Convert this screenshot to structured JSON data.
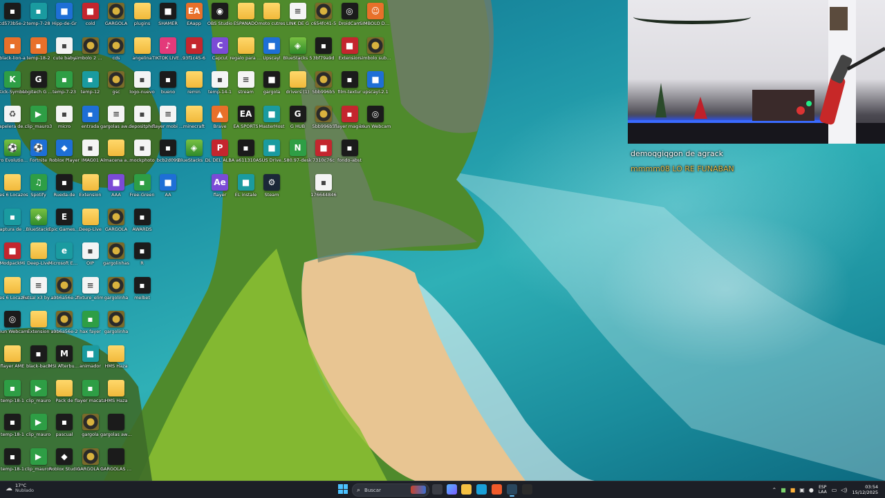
{
  "desktop": {
    "columns": [
      {
        "icons": [
          {
            "label": "cd573b5e-2",
            "icon": "image-file-icon",
            "style": "dark"
          },
          {
            "label": "black-lion-a",
            "icon": "image-file-icon",
            "style": "orange"
          },
          {
            "label": "Kick-Symbol",
            "icon": "kick-icon",
            "style": "green"
          },
          {
            "label": "Papelera de reciclaje",
            "icon": "recycle-bin-icon",
            "style": "doc"
          },
          {
            "label": "Pro Evolution Soccer 6",
            "icon": "game-icon",
            "style": "lime"
          },
          {
            "label": "Pes 6 Locazos",
            "icon": "folder-icon",
            "style": "folder"
          },
          {
            "label": "Captura de pantalla",
            "icon": "image-file-icon",
            "style": "teal"
          },
          {
            "label": "ModpackMi",
            "icon": "app-icon",
            "style": "red"
          },
          {
            "label": "Pes 6 Locazos",
            "icon": "folder-icon",
            "style": "folder"
          },
          {
            "label": "iriun Webcam",
            "icon": "webcam-icon",
            "style": "dark"
          },
          {
            "label": "flayer AME",
            "icon": "folder-icon",
            "style": "folder"
          },
          {
            "label": "temp-18-1",
            "icon": "image-file-icon",
            "style": "green"
          },
          {
            "label": "temp-18-1",
            "icon": "image-file-icon",
            "style": "dark"
          },
          {
            "label": "temp-18-1",
            "icon": "image-file-icon",
            "style": "dark"
          }
        ]
      },
      {
        "icons": [
          {
            "label": "temp-7-28",
            "icon": "image-file-icon",
            "style": "teal"
          },
          {
            "label": "temp-18-2",
            "icon": "image-file-icon",
            "style": "orange"
          },
          {
            "label": "Logitech G HUB",
            "icon": "logitech-icon",
            "style": "dark"
          },
          {
            "label": "clip_mauro3",
            "icon": "video-file-icon",
            "style": "green"
          },
          {
            "label": "Fortnite",
            "icon": "game-icon",
            "style": "blue"
          },
          {
            "label": "Spotify",
            "icon": "spotify-icon",
            "style": "green"
          },
          {
            "label": "BlueStacks",
            "icon": "bluestacks-icon",
            "style": "lime"
          },
          {
            "label": "Deep-Live",
            "icon": "folder-icon",
            "style": "folder"
          },
          {
            "label": "Futsal x3 by Bazinga",
            "icon": "document-icon",
            "style": "doc"
          },
          {
            "label": "Extension",
            "icon": "folder-icon",
            "style": "folder"
          },
          {
            "label": "black-back",
            "icon": "image-file-icon",
            "style": "dark"
          },
          {
            "label": "clip_mauro",
            "icon": "video-file-icon",
            "style": "green"
          },
          {
            "label": "clip_mauro",
            "icon": "video-file-icon",
            "style": "green"
          },
          {
            "label": "clip_mauro4",
            "icon": "video-file-icon",
            "style": "green"
          }
        ]
      },
      {
        "icons": [
          {
            "label": "Hipp-de-Gr",
            "icon": "app-icon",
            "style": "blue"
          },
          {
            "label": "cute baby",
            "icon": "image-file-icon",
            "style": "doc"
          },
          {
            "label": "temp-7-23",
            "icon": "image-file-icon",
            "style": "green"
          },
          {
            "label": "micro",
            "icon": "image-file-icon",
            "style": "doc"
          },
          {
            "label": "Roblox Player",
            "icon": "roblox-icon",
            "style": "blue"
          },
          {
            "label": "Rueda-de",
            "icon": "image-file-icon",
            "style": "dark"
          },
          {
            "label": "Epic Games Launcher",
            "icon": "epic-icon",
            "style": "dark"
          },
          {
            "label": "Microsoft Edge",
            "icon": "edge-icon",
            "style": "teal"
          },
          {
            "label": "a9b6a56e-2",
            "icon": "gold-logo-icon",
            "style": "gold"
          },
          {
            "label": "a9b6a56e-2",
            "icon": "gold-logo-icon",
            "style": "gold"
          },
          {
            "label": "MSI Afterburner",
            "icon": "msi-icon",
            "style": "dark"
          },
          {
            "label": "Pack de",
            "icon": "folder-icon",
            "style": "folder"
          },
          {
            "label": "pascual",
            "icon": "image-file-icon",
            "style": "dark"
          },
          {
            "label": "Roblox Studio",
            "icon": "roblox-icon",
            "style": "dark"
          }
        ]
      },
      {
        "icons": [
          {
            "label": "cold",
            "icon": "app-icon",
            "style": "red"
          },
          {
            "label": "simbolo 2 meses",
            "icon": "gold-logo-icon",
            "style": "gold"
          },
          {
            "label": "temp-12",
            "icon": "image-file-icon",
            "style": "teal"
          },
          {
            "label": "entrada",
            "icon": "image-file-icon",
            "style": "blue"
          },
          {
            "label": "IMAG01",
            "icon": "image-file-icon",
            "style": "doc"
          },
          {
            "label": "Extension",
            "icon": "folder-icon",
            "style": "folder"
          },
          {
            "label": "Deep-Live",
            "icon": "folder-icon",
            "style": "folder"
          },
          {
            "label": "OIP",
            "icon": "image-file-icon",
            "style": "doc"
          },
          {
            "label": "fixture_elim",
            "icon": "document-icon",
            "style": "doc"
          },
          {
            "label": "hax fayer",
            "icon": "image-file-icon",
            "style": "green"
          },
          {
            "label": "animador",
            "icon": "app-icon",
            "style": "teal"
          },
          {
            "label": "flayer macata",
            "icon": "image-file-icon",
            "style": "green"
          },
          {
            "label": "gargola",
            "icon": "gold-logo-icon",
            "style": "gold"
          },
          {
            "label": "GARGOLA 1",
            "icon": "gold-logo-icon",
            "style": "gold"
          }
        ]
      },
      {
        "icons": [
          {
            "label": "GARGOLA",
            "icon": "gold-logo-icon",
            "style": "gold"
          },
          {
            "label": "cds",
            "icon": "gold-logo-icon",
            "style": "gold"
          },
          {
            "label": "gsc",
            "icon": "gold-logo-icon",
            "style": "gold"
          },
          {
            "label": "gargolas awards",
            "icon": "document-icon",
            "style": "doc"
          },
          {
            "label": "Almacena automatic",
            "icon": "folder-icon",
            "style": "folder"
          },
          {
            "label": "AAA",
            "icon": "app-icon",
            "style": "purple"
          },
          {
            "label": "GARGOLA",
            "icon": "gold-logo-icon",
            "style": "gold"
          },
          {
            "label": "gargolinhas",
            "icon": "gold-logo-icon",
            "style": "gold"
          },
          {
            "label": "gargolinha",
            "icon": "gold-logo-icon",
            "style": "gold"
          },
          {
            "label": "gargolinha",
            "icon": "gold-logo-icon",
            "style": "gold"
          },
          {
            "label": "HMS Haza",
            "icon": "folder-icon",
            "style": "folder"
          },
          {
            "label": "HMS Haza",
            "icon": "folder-icon",
            "style": "folder"
          },
          {
            "label": "gargolas awards",
            "icon": "gold-logo-icon",
            "style": "dark"
          },
          {
            "label": "GARGOLAS AWARDS",
            "icon": "gold-logo-icon",
            "style": "dark"
          }
        ]
      },
      {
        "icons": [
          {
            "label": "plugins",
            "icon": "folder-icon",
            "style": "folder"
          },
          {
            "label": "angelina",
            "icon": "folder-icon",
            "style": "folder"
          },
          {
            "label": "logo-nuevo",
            "icon": "image-file-icon",
            "style": "doc"
          },
          {
            "label": "depositphot",
            "icon": "image-file-icon",
            "style": "doc"
          },
          {
            "label": "mockphoto",
            "icon": "image-file-icon",
            "style": "doc"
          },
          {
            "label": "Free-Green",
            "icon": "image-file-icon",
            "style": "green"
          },
          {
            "label": "AWARDS",
            "icon": "image-file-icon",
            "style": "dark"
          },
          {
            "label": "R",
            "icon": "image-file-icon",
            "style": "dark"
          },
          {
            "label": "melbet",
            "icon": "image-file-icon",
            "style": "dark"
          }
        ]
      },
      {
        "icons": [
          {
            "label": "SHAMER",
            "icon": "app-icon",
            "style": "dark"
          },
          {
            "label": "TIKTOK LIVE Studio",
            "icon": "tiktok-icon",
            "style": "pink"
          },
          {
            "label": "bueno",
            "icon": "image-file-icon",
            "style": "dark"
          },
          {
            "label": "flayer mobi carrera",
            "icon": "document-icon",
            "style": "doc"
          },
          {
            "label": "bcb2d099",
            "icon": "image-file-icon",
            "style": "dark"
          },
          {
            "label": "AA",
            "icon": "app-icon",
            "style": "blue"
          }
        ]
      },
      {
        "icons": [
          {
            "label": "EAapp",
            "icon": "ea-icon",
            "style": "orange"
          },
          {
            "label": "93f1c45-6",
            "icon": "image-file-icon",
            "style": "red"
          },
          {
            "label": "remin",
            "icon": "folder-icon",
            "style": "folder"
          },
          {
            "label": "minecraft",
            "icon": "folder-icon",
            "style": "folder"
          },
          {
            "label": "BlueStacks Multi-Instan",
            "icon": "bluestacks-icon",
            "style": "lime"
          }
        ]
      }
    ],
    "columns2": [
      {
        "icons": [
          {
            "label": "OBS Studio",
            "icon": "obs-icon",
            "style": "dark"
          },
          {
            "label": "Capcut",
            "icon": "capcut-icon",
            "style": "purple"
          },
          {
            "label": "temp-14-1",
            "icon": "image-file-icon",
            "style": "doc"
          },
          {
            "label": "Brave",
            "icon": "brave-icon",
            "style": "orange"
          },
          {
            "label": "DL DEL ALBA",
            "icon": "pdf-icon",
            "style": "red"
          },
          {
            "label": "flayer",
            "icon": "ae-icon",
            "style": "purple"
          }
        ]
      },
      {
        "icons": [
          {
            "label": "ESPANADO",
            "icon": "folder-icon",
            "style": "folder"
          },
          {
            "label": "regalo para roguel",
            "icon": "folder-icon",
            "style": "folder"
          },
          {
            "label": "stream",
            "icon": "document-icon",
            "style": "doc"
          },
          {
            "label": "EA SPORTS",
            "icon": "ea-icon",
            "style": "dark"
          },
          {
            "label": "a611310",
            "icon": "image-file-icon",
            "style": "dark"
          },
          {
            "label": "EL instale",
            "icon": "app-icon",
            "style": "teal"
          }
        ]
      },
      {
        "icons": [
          {
            "label": "moto cutres",
            "icon": "folder-icon",
            "style": "folder"
          },
          {
            "label": "Upscayl",
            "icon": "app-icon",
            "style": "blue"
          },
          {
            "label": "gargola",
            "icon": "app-icon",
            "style": "dark"
          },
          {
            "label": "MasterHost",
            "icon": "app-icon",
            "style": "teal"
          },
          {
            "label": "ASUS DriveHub",
            "icon": "app-icon",
            "style": "teal"
          },
          {
            "label": "Steam",
            "icon": "steam-icon",
            "style": "steam"
          }
        ]
      },
      {
        "icons": [
          {
            "label": "LINK DE G",
            "icon": "document-icon",
            "style": "doc"
          },
          {
            "label": "BlueStacks 5",
            "icon": "bluestacks-icon",
            "style": "lime"
          },
          {
            "label": "drivers (1)",
            "icon": "folder-icon",
            "style": "folder"
          },
          {
            "label": "G HUB",
            "icon": "logitech-icon",
            "style": "dark"
          },
          {
            "label": "580.97-desk",
            "icon": "nvidia-icon",
            "style": "green"
          }
        ]
      },
      {
        "icons": [
          {
            "label": "c654fc41-5",
            "icon": "gold-logo-icon",
            "style": "gold"
          },
          {
            "label": "3bf79a9d",
            "icon": "image-file-icon",
            "style": "dark"
          },
          {
            "label": "5bb996b5",
            "icon": "gold-logo-icon",
            "style": "gold"
          },
          {
            "label": "5bb996b5",
            "icon": "gold-logo-icon",
            "style": "gold"
          },
          {
            "label": "7310c76c",
            "icon": "app-icon",
            "style": "red"
          },
          {
            "label": "176644846",
            "icon": "image-file-icon",
            "style": "doc"
          }
        ]
      },
      {
        "icons": [
          {
            "label": "DroidCam",
            "icon": "droidcam-icon",
            "style": "dark"
          },
          {
            "label": "Extension",
            "icon": "app-icon",
            "style": "red"
          },
          {
            "label": "film-textur",
            "icon": "image-file-icon",
            "style": "dark"
          },
          {
            "label": "flayer magico",
            "icon": "image-file-icon",
            "style": "red"
          },
          {
            "label": "fondo-abst",
            "icon": "image-file-icon",
            "style": "dark"
          }
        ]
      },
      {
        "icons": [
          {
            "label": "SIMBOLO DE SUB",
            "icon": "monkey-icon",
            "style": "orange"
          },
          {
            "label": "simbolo sub pibla",
            "icon": "gold-logo-icon",
            "style": "gold"
          },
          {
            "label": "upscayl-2.1",
            "icon": "app-icon",
            "style": "blue"
          },
          {
            "label": "iriun Webcam",
            "icon": "webcam-icon",
            "style": "dark"
          }
        ]
      }
    ]
  },
  "webcam": {
    "chat": [
      {
        "user": "demoqgiqgon de agrack",
        "color": "#ffffff"
      },
      {
        "user": "mmmm08",
        "message": "LO RE FUNABAN",
        "color": "#e0b84a"
      }
    ]
  },
  "taskbar": {
    "weather": {
      "temp": "17°C",
      "condition": "Nublado"
    },
    "search_placeholder": "Buscar",
    "apps": [
      {
        "name": "file-explorer-icon",
        "color": "#f4c043"
      },
      {
        "name": "edge-icon",
        "color": "#1aa0d8"
      },
      {
        "name": "brave-icon",
        "color": "#f05a2a"
      },
      {
        "name": "steam-icon",
        "color": "#2a475e"
      },
      {
        "name": "obs-icon",
        "color": "#2b2b2b"
      }
    ],
    "tray": {
      "lang_top": "ESP",
      "lang_bottom": "LAA",
      "time": "03:54",
      "date": "15/12/2025"
    }
  }
}
